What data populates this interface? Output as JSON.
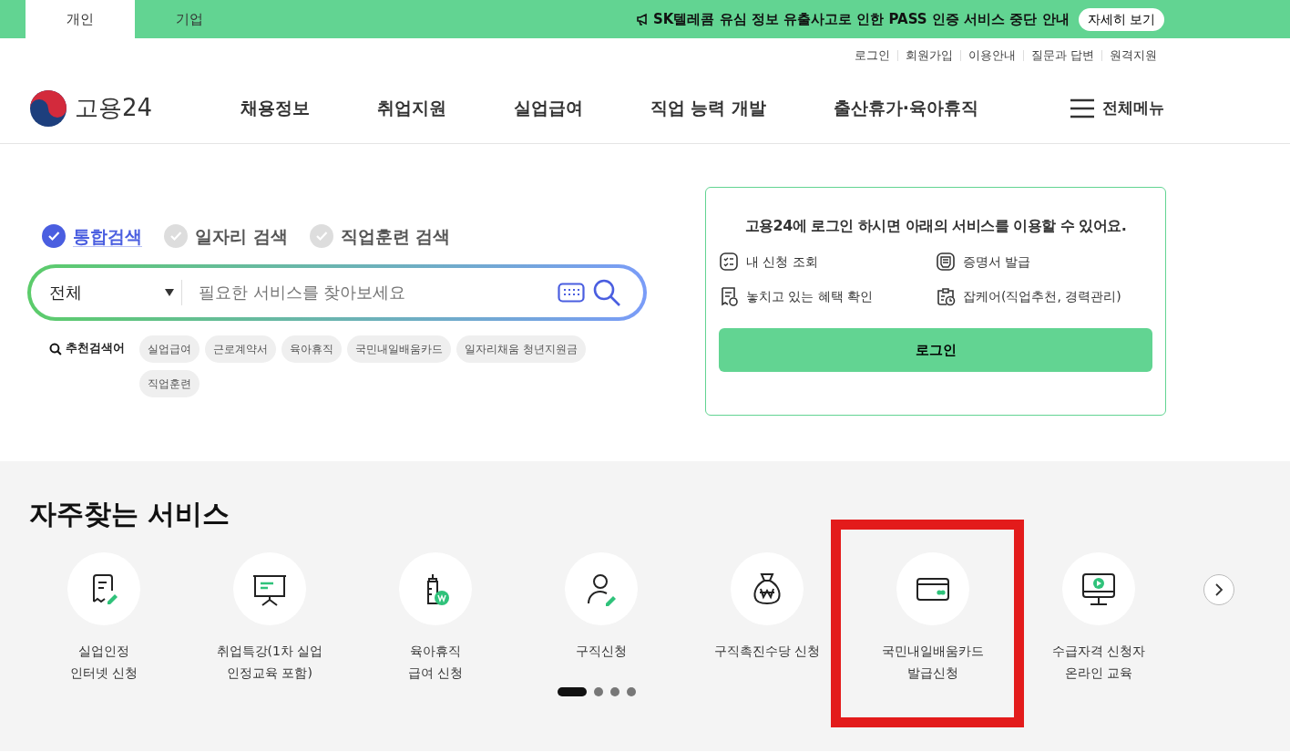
{
  "top_bar": {
    "tabs": [
      {
        "label": "개인",
        "selected": true
      },
      {
        "label": "기업",
        "selected": false
      }
    ],
    "notice": "SK텔레콤 유심 정보 유출사고로 인한 PASS 인증 서비스 중단 안내",
    "notice_button": "자세히 보기"
  },
  "util_links": [
    "로그인",
    "회원가입",
    "이용안내",
    "질문과 답변",
    "원격지원"
  ],
  "logo": "고용24",
  "nav": [
    "채용정보",
    "취업지원",
    "실업급여",
    "직업 능력 개발",
    "출산휴가·육아휴직"
  ],
  "all_menu": "전체메뉴",
  "search": {
    "types": [
      {
        "label": "통합검색",
        "selected": true
      },
      {
        "label": "일자리 검색",
        "selected": false
      },
      {
        "label": "직업훈련 검색",
        "selected": false
      }
    ],
    "category": "전체",
    "placeholder": "필요한 서비스를 찾아보세요",
    "recommended_label": "추천검색어",
    "keywords": [
      "실업급여",
      "근로계약서",
      "육아휴직",
      "국민내일배움카드",
      "일자리채움 청년지원금",
      "직업훈련"
    ]
  },
  "login_card": {
    "message": "고용24에 **로그인** 하시면 아래의 서비스를 이용할 수 있어요.",
    "services": [
      {
        "kind": "list",
        "label": "내 신청 조회"
      },
      {
        "kind": "certificate",
        "label": "증명서 발급"
      },
      {
        "kind": "benefit",
        "label": "놓치고 있는 혜택 확인"
      },
      {
        "kind": "clipboard",
        "label": "잡케어(직업추천, 경력관리)"
      }
    ],
    "button": "로그인"
  },
  "frequent": {
    "title": "자주찾는 서비스",
    "items": [
      {
        "kind": "receipt",
        "lines": [
          "실업인정",
          "인터넷 신청"
        ],
        "highlighted": false
      },
      {
        "kind": "board",
        "lines": [
          "취업특강(1차 실업",
          "인정교육 포함)"
        ],
        "highlighted": false
      },
      {
        "kind": "bottle",
        "lines": [
          "육아휴직",
          "급여 신청"
        ],
        "highlighted": false
      },
      {
        "kind": "person",
        "lines": [
          "구직신청"
        ],
        "highlighted": false
      },
      {
        "kind": "moneybag",
        "lines": [
          "구직촉진수당 신청"
        ],
        "highlighted": false
      },
      {
        "kind": "card",
        "lines": [
          "국민내일배움카드",
          "발급신청"
        ],
        "highlighted": true
      },
      {
        "kind": "monitor",
        "lines": [
          "수급자격 신청자",
          "온라인 교육"
        ],
        "highlighted": false
      }
    ],
    "pager": [
      {
        "selected": true
      },
      {
        "selected": false
      },
      {
        "selected": false
      },
      {
        "selected": false
      }
    ]
  }
}
